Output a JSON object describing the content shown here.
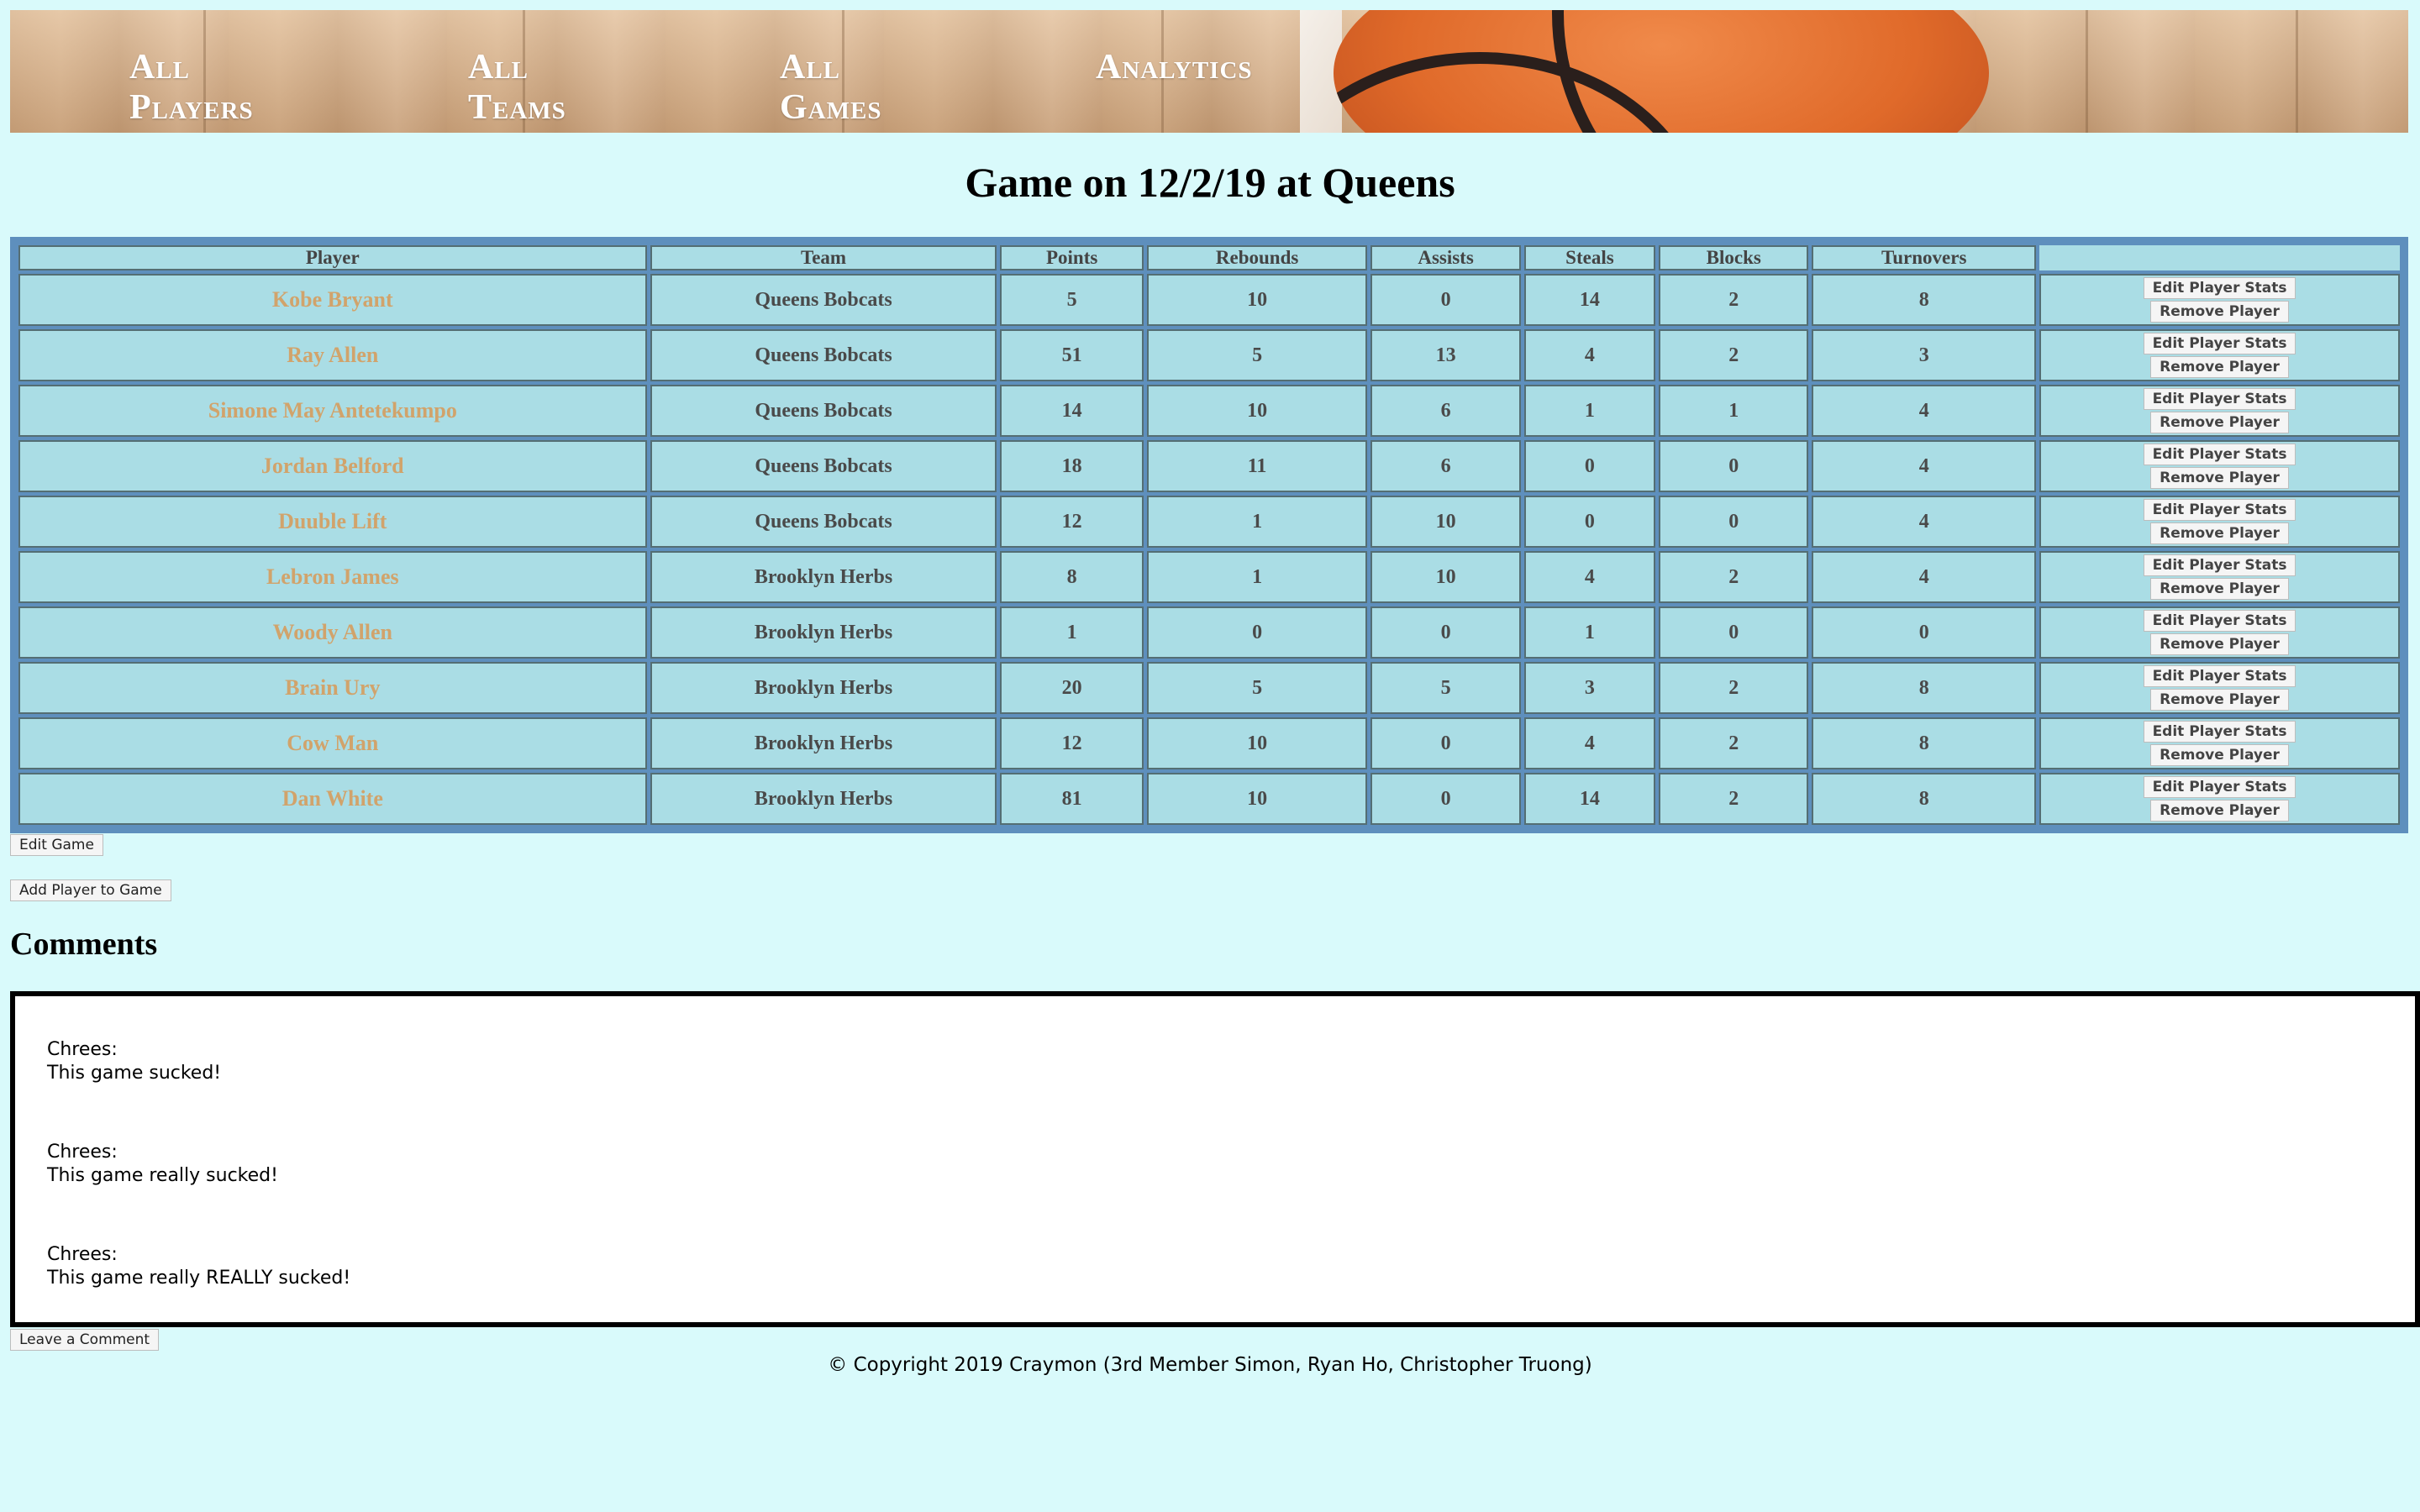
{
  "nav": {
    "items": [
      "All Players",
      "All Teams",
      "All Games",
      "Analytics"
    ]
  },
  "page": {
    "title": "Game on 12/2/19 at Queens"
  },
  "table": {
    "headers": [
      "Player",
      "Team",
      "Points",
      "Rebounds",
      "Assists",
      "Steals",
      "Blocks",
      "Turnovers"
    ],
    "rows": [
      [
        "Kobe Bryant",
        "Queens Bobcats",
        "5",
        "10",
        "0",
        "14",
        "2",
        "8"
      ],
      [
        "Ray Allen",
        "Queens Bobcats",
        "51",
        "5",
        "13",
        "4",
        "2",
        "3"
      ],
      [
        "Simone May Antetekumpo",
        "Queens Bobcats",
        "14",
        "10",
        "6",
        "1",
        "1",
        "4"
      ],
      [
        "Jordan Belford",
        "Queens Bobcats",
        "18",
        "11",
        "6",
        "0",
        "0",
        "4"
      ],
      [
        "Duuble Lift",
        "Queens Bobcats",
        "12",
        "1",
        "10",
        "0",
        "0",
        "4"
      ],
      [
        "Lebron James",
        "Brooklyn Herbs",
        "8",
        "1",
        "10",
        "4",
        "2",
        "4"
      ],
      [
        "Woody Allen",
        "Brooklyn Herbs",
        "1",
        "0",
        "0",
        "1",
        "0",
        "0"
      ],
      [
        "Brain Ury",
        "Brooklyn Herbs",
        "20",
        "5",
        "5",
        "3",
        "2",
        "8"
      ],
      [
        "Cow Man",
        "Brooklyn Herbs",
        "12",
        "10",
        "0",
        "4",
        "2",
        "8"
      ],
      [
        "Dan White",
        "Brooklyn Herbs",
        "81",
        "10",
        "0",
        "14",
        "2",
        "8"
      ]
    ],
    "edit_stats_label": "Edit Player Stats",
    "remove_label": "Remove Player"
  },
  "actions": {
    "edit_game": "Edit Game",
    "add_player": "Add Player to Game"
  },
  "comments": {
    "heading": "Comments",
    "items": [
      {
        "author": "Chrees:",
        "text": "This game sucked!"
      },
      {
        "author": "Chrees:",
        "text": "This game really sucked!"
      },
      {
        "author": "Chrees:",
        "text": "This game really REALLY sucked!"
      }
    ],
    "leave_label": "Leave a Comment"
  },
  "footer": {
    "text": "© Copyright 2019 Craymon (3rd Member Simon, Ryan Ho, Christopher Truong)"
  },
  "colors": {
    "background": "#d9fafb",
    "table_border": "#5e8fbd",
    "cell": "#aadde5",
    "player_name": "#d1a36b"
  }
}
